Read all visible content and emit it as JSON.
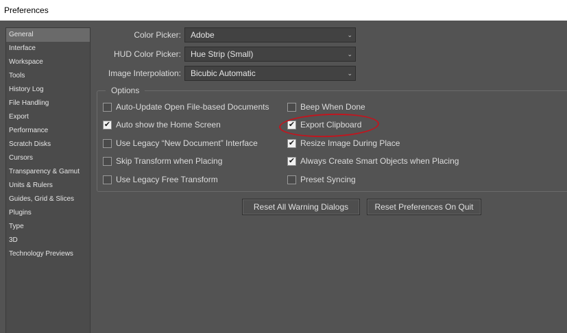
{
  "window": {
    "title": "Preferences"
  },
  "sidebar": {
    "items": [
      {
        "label": "General",
        "selected": true
      },
      {
        "label": "Interface"
      },
      {
        "label": "Workspace"
      },
      {
        "label": "Tools"
      },
      {
        "label": "History Log"
      },
      {
        "label": "File Handling"
      },
      {
        "label": "Export"
      },
      {
        "label": "Performance"
      },
      {
        "label": "Scratch Disks"
      },
      {
        "label": "Cursors"
      },
      {
        "label": "Transparency & Gamut"
      },
      {
        "label": "Units & Rulers"
      },
      {
        "label": "Guides, Grid & Slices"
      },
      {
        "label": "Plugins"
      },
      {
        "label": "Type"
      },
      {
        "label": "3D"
      },
      {
        "label": "Technology Previews"
      }
    ]
  },
  "fields": {
    "color_picker": {
      "label": "Color Picker:",
      "value": "Adobe"
    },
    "hud_color_picker": {
      "label": "HUD Color Picker:",
      "value": "Hue Strip (Small)"
    },
    "image_interpolation": {
      "label": "Image Interpolation:",
      "value": "Bicubic Automatic"
    }
  },
  "options": {
    "title": "Options",
    "auto_update": {
      "label": "Auto-Update Open File-based Documents",
      "checked": false
    },
    "auto_show_home": {
      "label": "Auto show the Home Screen",
      "checked": true
    },
    "legacy_new_doc": {
      "label": "Use Legacy “New Document” Interface",
      "checked": false
    },
    "skip_transform": {
      "label": "Skip Transform when Placing",
      "checked": false
    },
    "legacy_free_transform": {
      "label": "Use Legacy Free Transform",
      "checked": false
    },
    "beep_when_done": {
      "label": "Beep When Done",
      "checked": false
    },
    "export_clipboard": {
      "label": "Export Clipboard",
      "checked": true
    },
    "resize_image": {
      "label": "Resize Image During Place",
      "checked": true
    },
    "smart_objects": {
      "label": "Always Create Smart Objects when Placing",
      "checked": true
    },
    "preset_syncing": {
      "label": "Preset Syncing",
      "checked": false
    }
  },
  "buttons": {
    "reset_warnings": "Reset All Warning Dialogs",
    "reset_prefs": "Reset Preferences On Quit"
  },
  "colors": {
    "background": "#535353",
    "sidebar": "#4b4b4b",
    "selected": "#6a6a6a",
    "annotation": "#c2151e"
  }
}
